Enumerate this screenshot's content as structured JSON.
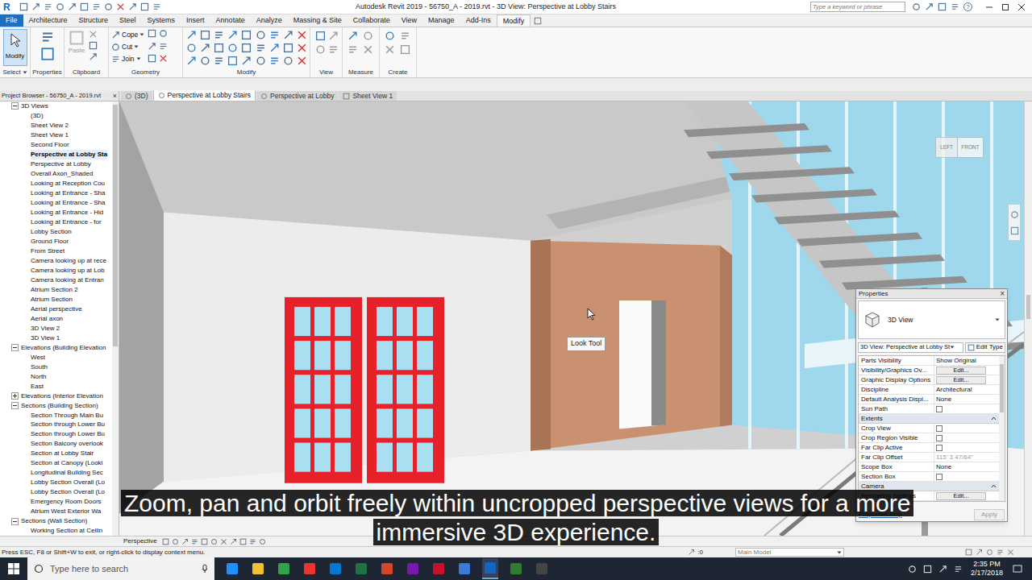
{
  "app_logo": "R",
  "window": {
    "title": "Autodesk Revit 2019 - 56750_A - 2019.rvt - 3D View: Perspective at Lobby Stairs",
    "search_placeholder": "Type a keyword or phrase",
    "help": "?"
  },
  "ribbon_tabs": [
    {
      "label": "File",
      "kind": "application",
      "selected": false
    },
    {
      "label": "Architecture",
      "kind": "tab",
      "selected": false
    },
    {
      "label": "Structure",
      "kind": "tab",
      "selected": false
    },
    {
      "label": "Steel",
      "kind": "tab",
      "selected": false
    },
    {
      "label": "Systems",
      "kind": "tab",
      "selected": false
    },
    {
      "label": "Insert",
      "kind": "tab",
      "selected": false
    },
    {
      "label": "Annotate",
      "kind": "tab",
      "selected": false
    },
    {
      "label": "Analyze",
      "kind": "tab",
      "selected": false
    },
    {
      "label": "Massing & Site",
      "kind": "tab",
      "selected": false
    },
    {
      "label": "Collaborate",
      "kind": "tab",
      "selected": false
    },
    {
      "label": "View",
      "kind": "tab",
      "selected": false
    },
    {
      "label": "Manage",
      "kind": "tab",
      "selected": false
    },
    {
      "label": "Add-Ins",
      "kind": "tab",
      "selected": false
    },
    {
      "label": "Modify",
      "kind": "tab",
      "selected": true
    }
  ],
  "ribbon": {
    "groups": [
      "Select",
      "Properties",
      "Clipboard",
      "Geometry",
      "Modify",
      "View",
      "Measure",
      "Create"
    ],
    "modify_button": "Modify",
    "paste": {
      "label": "Paste",
      "disabled": true
    },
    "geometry_tools": [
      "Cope",
      "Cut",
      "Join"
    ]
  },
  "project_browser": {
    "title": "Project Browser - 56750_A - 2019.rvt",
    "close": "×",
    "items": [
      {
        "label": "3D Views",
        "kind": "folder",
        "expanded": true,
        "selected": false
      },
      {
        "label": "(3D)",
        "kind": "view",
        "selected": false
      },
      {
        "label": "Sheet View 2",
        "kind": "view",
        "selected": false
      },
      {
        "label": "Sheet View 1",
        "kind": "view",
        "selected": false
      },
      {
        "label": "Second Floor",
        "kind": "view",
        "selected": false
      },
      {
        "label": "Perspective at Lobby Sta",
        "kind": "view",
        "selected": true
      },
      {
        "label": "Perspective at Lobby",
        "kind": "view",
        "selected": false
      },
      {
        "label": "Overall Axon_Shaded",
        "kind": "view",
        "selected": false
      },
      {
        "label": "Looking at Reception Cou",
        "kind": "view",
        "selected": false
      },
      {
        "label": "Looking at Entrance - Sha",
        "kind": "view",
        "selected": false
      },
      {
        "label": "Looking at Entrance - Sha",
        "kind": "view",
        "selected": false
      },
      {
        "label": "Looking at Entrance - Hid",
        "kind": "view",
        "selected": false
      },
      {
        "label": "Looking at Entrance - for",
        "kind": "view",
        "selected": false
      },
      {
        "label": "Lobby Section",
        "kind": "view",
        "selected": false
      },
      {
        "label": "Ground Floor",
        "kind": "view",
        "selected": false
      },
      {
        "label": "From Street",
        "kind": "view",
        "selected": false
      },
      {
        "label": "Camera looking up at rece",
        "kind": "view",
        "selected": false
      },
      {
        "label": "Camera looking up at Lob",
        "kind": "view",
        "selected": false
      },
      {
        "label": "Camera looking at Entran",
        "kind": "view",
        "selected": false
      },
      {
        "label": "Atrium Section 2",
        "kind": "view",
        "selected": false
      },
      {
        "label": "Atrium Section",
        "kind": "view",
        "selected": false
      },
      {
        "label": "Aerial perspective",
        "kind": "view",
        "selected": false
      },
      {
        "label": "Aerial axon",
        "kind": "view",
        "selected": false
      },
      {
        "label": "3D View 2",
        "kind": "view",
        "selected": false
      },
      {
        "label": "3D View 1",
        "kind": "view",
        "selected": false
      },
      {
        "label": "Elevations (Building Elevation",
        "kind": "folder",
        "expanded": true,
        "selected": false
      },
      {
        "label": "West",
        "kind": "view",
        "selected": false
      },
      {
        "label": "South",
        "kind": "view",
        "selected": false
      },
      {
        "label": "North",
        "kind": "view",
        "selected": false
      },
      {
        "label": "East",
        "kind": "view",
        "selected": false
      },
      {
        "label": "Elevations (Interior Elevation",
        "kind": "folder",
        "expanded": false,
        "selected": false
      },
      {
        "label": "Sections (Building Section)",
        "kind": "folder",
        "expanded": true,
        "selected": false
      },
      {
        "label": "Section Through Main Bu",
        "kind": "view",
        "selected": false
      },
      {
        "label": "Section through Lower Bu",
        "kind": "view",
        "selected": false
      },
      {
        "label": "Section through Lower Bu",
        "kind": "view",
        "selected": false
      },
      {
        "label": "Section Balcony overlook",
        "kind": "view",
        "selected": false
      },
      {
        "label": "Section at Lobby Stair",
        "kind": "view",
        "selected": false
      },
      {
        "label": "Section at Canopy (Looki",
        "kind": "view",
        "selected": false
      },
      {
        "label": "Longitudinal Building Sec",
        "kind": "view",
        "selected": false
      },
      {
        "label": "Lobby Section Overall (Lo",
        "kind": "view",
        "selected": false
      },
      {
        "label": "Lobby Section Overall (Lo",
        "kind": "view",
        "selected": false
      },
      {
        "label": "Emergency Room Doors",
        "kind": "view",
        "selected": false
      },
      {
        "label": "Atrium West Exterior Wa",
        "kind": "view",
        "selected": false
      },
      {
        "label": "Sections (Wall Section)",
        "kind": "folder",
        "expanded": true,
        "selected": false
      },
      {
        "label": "Working Section at Ceilin",
        "kind": "view",
        "selected": false
      }
    ]
  },
  "view_tabs": [
    {
      "label": "(3D)",
      "selected": false
    },
    {
      "label": "Perspective at Lobby Stairs",
      "selected": true
    },
    {
      "label": "Perspective at Lobby",
      "selected": false
    },
    {
      "label": "Sheet View 1",
      "selected": false
    }
  ],
  "viewport": {
    "tooltip": "Look Tool",
    "view_cube": [
      "LEFT",
      "FRONT"
    ]
  },
  "properties": {
    "title": "Properties",
    "close": "×",
    "type_name": "3D View",
    "instance_selector": "3D View: Perspective at Lobby St",
    "edit_type": "Edit Type",
    "rows": [
      {
        "kind": "value",
        "label": "Parts Visibility",
        "value": "Show Original",
        "disabled": false
      },
      {
        "kind": "button",
        "label": "Visibility/Graphics Ov...",
        "value": "Edit..."
      },
      {
        "kind": "button",
        "label": "Graphic Display Options",
        "value": "Edit..."
      },
      {
        "kind": "value",
        "label": "Discipline",
        "value": "Architectural",
        "disabled": false
      },
      {
        "kind": "value",
        "label": "Default Analysis Displ...",
        "value": "None",
        "disabled": false
      },
      {
        "kind": "checkbox",
        "label": "Sun Path",
        "checked": false
      },
      {
        "kind": "section",
        "label": "Extents",
        "expanded": true
      },
      {
        "kind": "checkbox",
        "label": "Crop View",
        "checked": false
      },
      {
        "kind": "checkbox",
        "label": "Crop Region Visible",
        "checked": false
      },
      {
        "kind": "checkbox",
        "label": "Far Clip Active",
        "checked": false
      },
      {
        "kind": "value",
        "label": "Far Clip Offset",
        "value": "115' 3 47/64\"",
        "disabled": true
      },
      {
        "kind": "value",
        "label": "Scope Box",
        "value": "None",
        "disabled": false
      },
      {
        "kind": "checkbox",
        "label": "Section Box",
        "checked": false
      },
      {
        "kind": "section",
        "label": "Camera",
        "expanded": true
      },
      {
        "kind": "button",
        "label": "Rendering Settings",
        "value": "Edit..."
      }
    ],
    "help": "Properties help",
    "apply": {
      "label": "Apply",
      "disabled": true
    }
  },
  "caption": "Zoom, pan and orbit freely within uncropped perspective views for a more immersive 3D experience.",
  "view_control_bar": {
    "view_type": "Perspective"
  },
  "status_bar": {
    "message": "Press ESC, F8 or Shift+W to exit, or right-click to display context menu.",
    "selection_count": ":0",
    "model": "Main Model"
  },
  "taskbar": {
    "search_placeholder": "Type here to search",
    "time": "2:35 PM",
    "date": "2/17/2018"
  }
}
